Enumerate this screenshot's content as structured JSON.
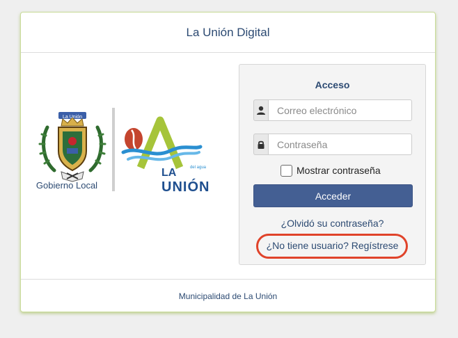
{
  "header": {
    "title": "La Unión Digital"
  },
  "logos": {
    "emblem_banner": "La Unión",
    "gov_label": "Gobierno Local",
    "brand_small": "del agua",
    "brand_la": "LA",
    "brand_union": "UNIÓN"
  },
  "login": {
    "title": "Acceso",
    "email_placeholder": "Correo electrónico",
    "password_placeholder": "Contraseña",
    "show_password_label": "Mostrar contraseña",
    "submit_label": "Acceder",
    "forgot_link": "¿Olvidó su contraseña?",
    "register_link": "¿No tiene usuario? Regístrese"
  },
  "footer": {
    "text": "Municipalidad de La Unión"
  },
  "colors": {
    "primary_button": "#445f93",
    "link": "#2c4a72",
    "highlight_ring": "#e0432a",
    "card_border": "#c9dc9a"
  }
}
